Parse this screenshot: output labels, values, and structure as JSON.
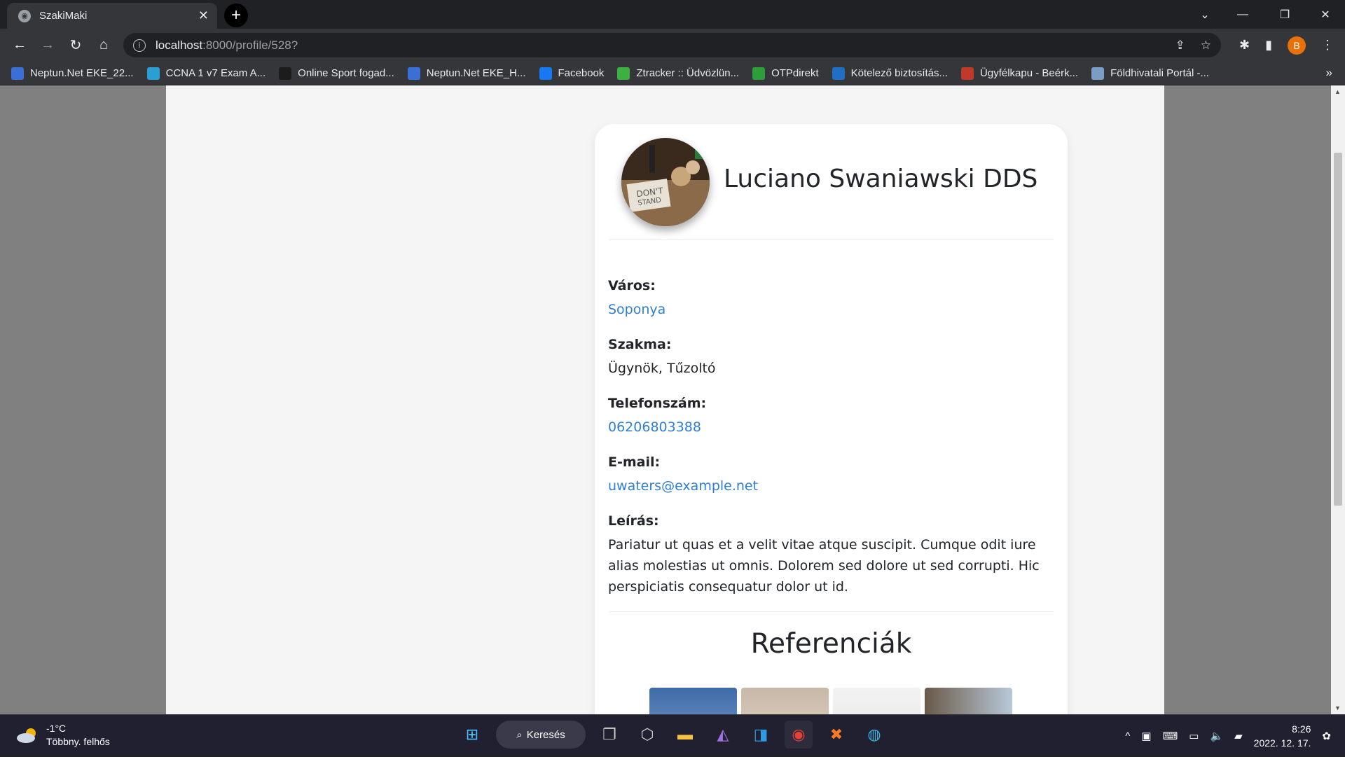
{
  "browser": {
    "tab_title": "SzakiMaki",
    "url_host": "localhost",
    "url_path": ":8000/profile/528?",
    "profile_initial": "B",
    "bookmarks": [
      {
        "label": "Neptun.Net EKE_22...",
        "color": "#3a6fd8"
      },
      {
        "label": "CCNA 1 v7 Exam A...",
        "color": "#2a9fd6"
      },
      {
        "label": "Online Sport fogad...",
        "color": "#1c1c1c"
      },
      {
        "label": "Neptun.Net EKE_H...",
        "color": "#3a6fd8"
      },
      {
        "label": "Facebook",
        "color": "#1877f2"
      },
      {
        "label": "Ztracker :: Üdvözlün...",
        "color": "#3cb043"
      },
      {
        "label": "OTPdirekt",
        "color": "#2e9e3a"
      },
      {
        "label": "Kötelező biztosítás...",
        "color": "#1f6fc4"
      },
      {
        "label": "Ügyfélkapu - Beérk...",
        "color": "#c0392b"
      },
      {
        "label": "Földhivatali Portál -...",
        "color": "#7a9cc6"
      }
    ]
  },
  "profile": {
    "name": "Luciano Swaniawski DDS",
    "city_label": "Város:",
    "city": "Soponya",
    "profession_label": "Szakma:",
    "profession": "Ügynök, Tűzoltó",
    "phone_label": "Telefonszám:",
    "phone": "06206803388",
    "email_label": "E-mail:",
    "email": "uwaters@example.net",
    "description_label": "Leírás:",
    "description": "Pariatur ut quas et a velit vitae atque suscipit. Cumque odit iure alias molestias ut omnis. Dolorem sed dolore ut sed corrupti. Hic perspiciatis consequatur dolor ut id.",
    "references_title": "Referenciák"
  },
  "taskbar": {
    "temperature": "-1°C",
    "weather": "Többny. felhős",
    "search_label": "Keresés",
    "time": "8:26",
    "date": "2022. 12. 17."
  }
}
